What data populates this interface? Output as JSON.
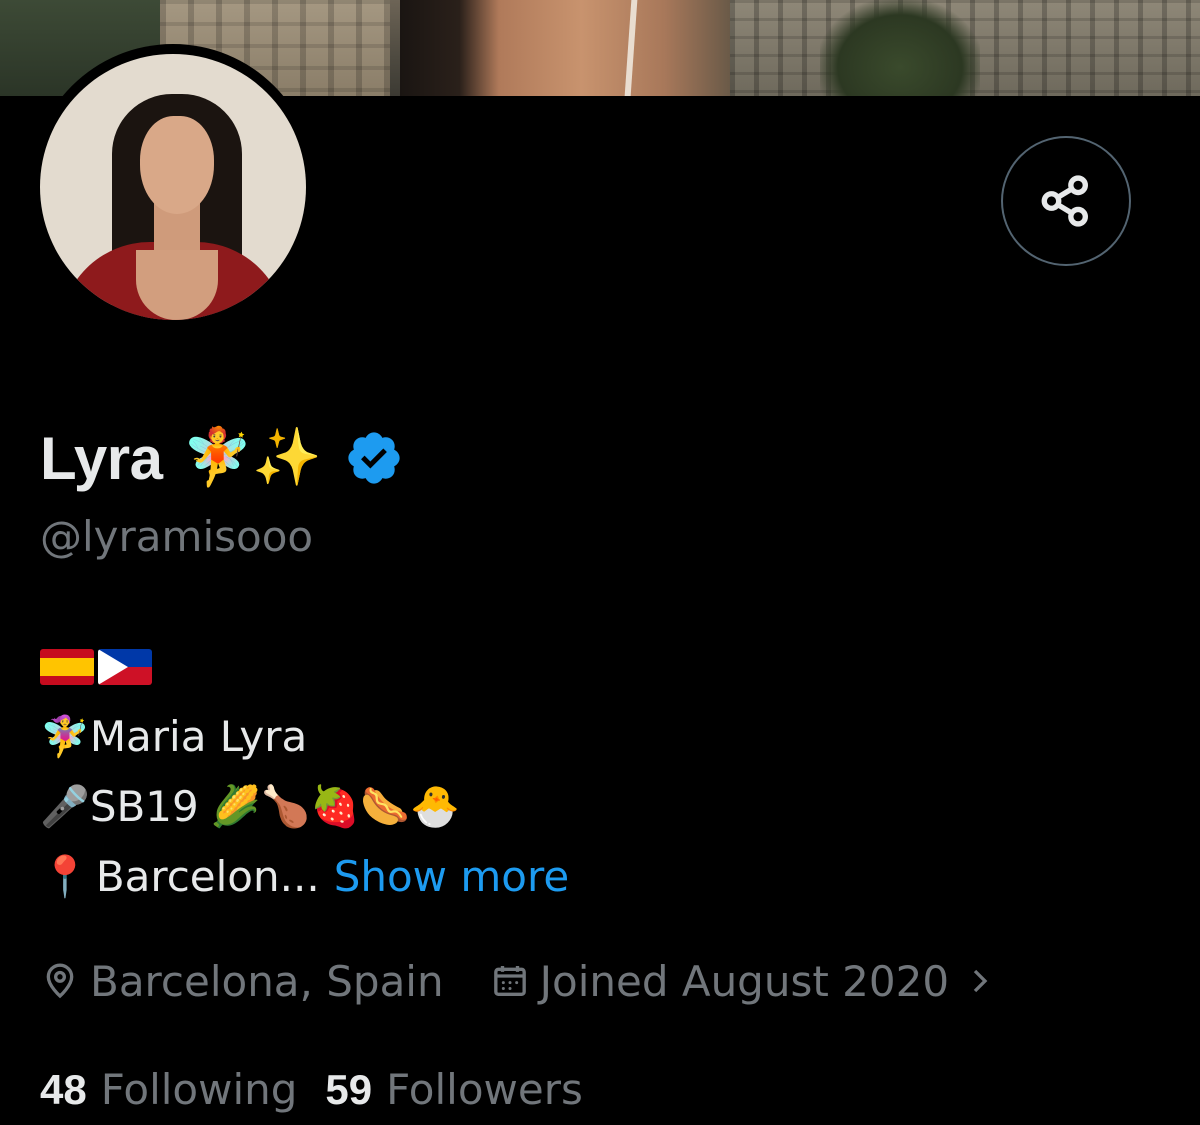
{
  "profile": {
    "display_name": "Lyra",
    "name_emojis": "🧚✨",
    "handle": "@lyramisooo",
    "verified": true
  },
  "bio": {
    "line1_flags": [
      "Spain flag",
      "Philippines flag"
    ],
    "line2_emoji": "🧚‍♀️",
    "line2_text": "Maria Lyra",
    "line3_emoji": "🎤",
    "line3_text": "SB19",
    "line3_trailing_emojis": "🌽🍗🍓🌭🐣",
    "line4_emoji": "📍",
    "line4_text": "Barcelon...",
    "show_more_label": "Show more"
  },
  "meta": {
    "location": "Barcelona, Spain",
    "joined": "Joined August 2020"
  },
  "counts": {
    "following_count": "48",
    "following_label": "Following",
    "followers_count": "59",
    "followers_label": "Followers"
  },
  "colors": {
    "background": "#000000",
    "primary_text": "#e7e9ea",
    "secondary_text": "#71767b",
    "accent": "#1d9bf0",
    "verified_badge": "#1d9bf0"
  },
  "icons": [
    "share-icon",
    "verified-badge-icon",
    "location-pin-icon",
    "calendar-icon",
    "chevron-right-icon"
  ]
}
